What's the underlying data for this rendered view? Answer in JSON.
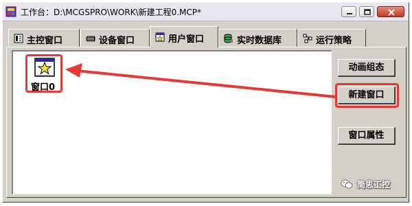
{
  "window": {
    "title": "工作台：D:\\MCGSPRO\\WORK\\新建工程0.MCP*"
  },
  "tabs": [
    {
      "label": "主控窗口",
      "icon": "main-window-icon",
      "active": false
    },
    {
      "label": "设备窗口",
      "icon": "device-icon",
      "active": false
    },
    {
      "label": "用户窗口",
      "icon": "user-window-icon",
      "active": true
    },
    {
      "label": "实时数据库",
      "icon": "database-icon",
      "active": false
    },
    {
      "label": "运行策略",
      "icon": "strategy-icon",
      "active": false
    }
  ],
  "content": {
    "window_item_label": "窗口0"
  },
  "side_buttons": {
    "animation": "动画组态",
    "new_window": "新建窗口",
    "properties": "窗口属性"
  },
  "watermark": {
    "text": "简思工控"
  },
  "colors": {
    "highlight_red": "#e53935",
    "face": "#d4d0c8"
  }
}
